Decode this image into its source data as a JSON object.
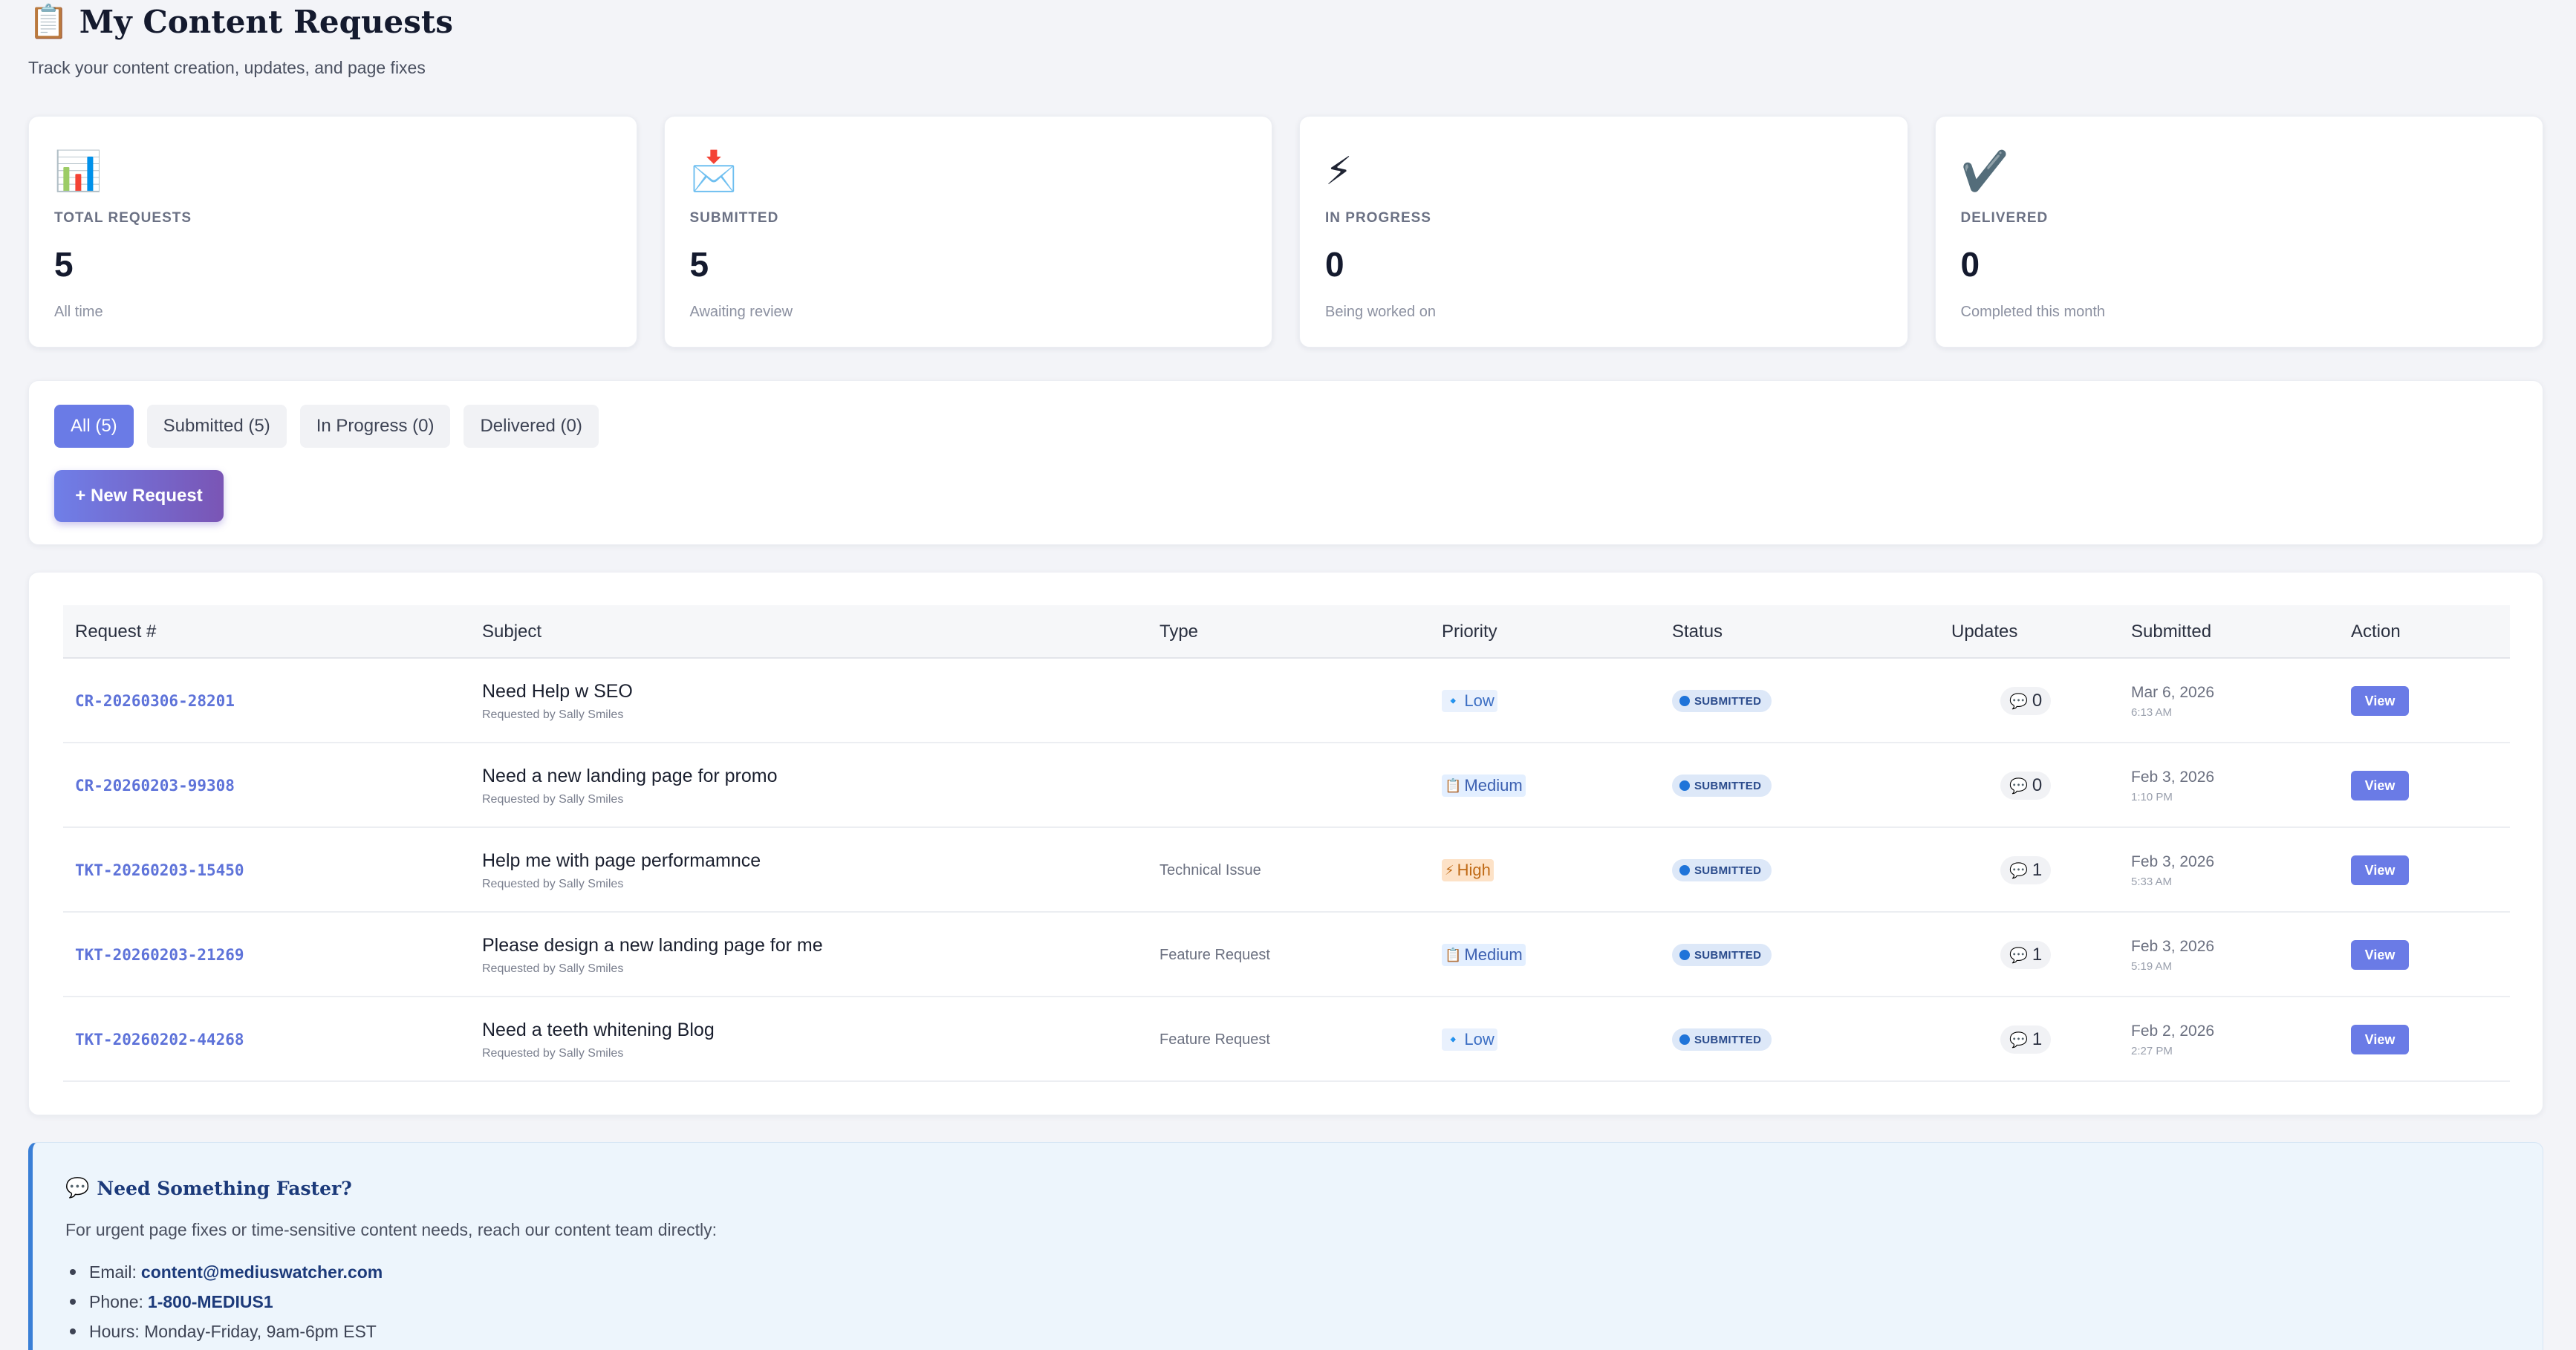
{
  "header": {
    "title_icon": "clipboard-icon",
    "title_icon_glyph": "📋",
    "title": "My Content Requests",
    "subtitle": "Track your content creation, updates, and page fixes"
  },
  "stats": [
    {
      "icon": "bar-chart-icon",
      "glyph": "📊",
      "label": "TOTAL REQUESTS",
      "value": "5",
      "note": "All time"
    },
    {
      "icon": "inbox-envelope-icon",
      "glyph": "📩",
      "label": "SUBMITTED",
      "value": "5",
      "note": "Awaiting review"
    },
    {
      "icon": "lightning-icon",
      "glyph": "⚡",
      "label": "IN PROGRESS",
      "value": "0",
      "note": "Being worked on"
    },
    {
      "icon": "checkmark-icon",
      "glyph": "✔️",
      "label": "DELIVERED",
      "value": "0",
      "note": "Completed this month"
    }
  ],
  "filters": {
    "tabs": [
      {
        "label": "All (5)",
        "active": true
      },
      {
        "label": "Submitted (5)",
        "active": false
      },
      {
        "label": "In Progress (0)",
        "active": false
      },
      {
        "label": "Delivered (0)",
        "active": false
      }
    ],
    "new_request_label": "+ New Request"
  },
  "table": {
    "columns": [
      "Request #",
      "Subject",
      "Type",
      "Priority",
      "Status",
      "Updates",
      "Submitted",
      "Action"
    ],
    "rows": [
      {
        "id": "CR-20260306-28201",
        "subject": "Need Help w SEO",
        "requester": "Requested by Sally Smiles",
        "type": "",
        "priority": "Low",
        "priority_icon": "🔹",
        "priority_class": "low",
        "status": "SUBMITTED",
        "updates": "0",
        "date": "Mar 6, 2026",
        "time": "6:13 AM",
        "action": "View"
      },
      {
        "id": "CR-20260203-99308",
        "subject": "Need a new landing page for promo",
        "requester": "Requested by Sally Smiles",
        "type": "",
        "priority": "Medium",
        "priority_icon": "📋",
        "priority_class": "medium",
        "status": "SUBMITTED",
        "updates": "0",
        "date": "Feb 3, 2026",
        "time": "1:10 PM",
        "action": "View"
      },
      {
        "id": "TKT-20260203-15450",
        "subject": "Help me with page performamnce",
        "requester": "Requested by Sally Smiles",
        "type": "Technical Issue",
        "priority": "High",
        "priority_icon": "⚡",
        "priority_class": "high",
        "status": "SUBMITTED",
        "updates": "1",
        "date": "Feb 3, 2026",
        "time": "5:33 AM",
        "action": "View"
      },
      {
        "id": "TKT-20260203-21269",
        "subject": "Please design a new landing page for me",
        "requester": "Requested by Sally Smiles",
        "type": "Feature Request",
        "priority": "Medium",
        "priority_icon": "📋",
        "priority_class": "medium",
        "status": "SUBMITTED",
        "updates": "1",
        "date": "Feb 3, 2026",
        "time": "5:19 AM",
        "action": "View"
      },
      {
        "id": "TKT-20260202-44268",
        "subject": "Need a teeth whitening Blog",
        "requester": "Requested by Sally Smiles",
        "type": "Feature Request",
        "priority": "Low",
        "priority_icon": "🔹",
        "priority_class": "low",
        "status": "SUBMITTED",
        "updates": "1",
        "date": "Feb 2, 2026",
        "time": "2:27 PM",
        "action": "View"
      }
    ]
  },
  "help": {
    "icon": "speech-bubble-icon",
    "glyph": "💬",
    "title": "Need Something Faster?",
    "text": "For urgent page fixes or time-sensitive content needs, reach our content team directly:",
    "items": [
      {
        "label": "Email:",
        "value": "content@mediuswatcher.com"
      },
      {
        "label": "Phone:",
        "value": "1-800-MEDIUS1"
      },
      {
        "label": "Hours: Monday-Friday, 9am-6pm EST",
        "value": ""
      }
    ]
  },
  "colors": {
    "accent": "#6a7be6",
    "button_gradient_end": "#7a55b5",
    "status_dot": "#1f74d9",
    "help_border": "#3a7fd6"
  }
}
